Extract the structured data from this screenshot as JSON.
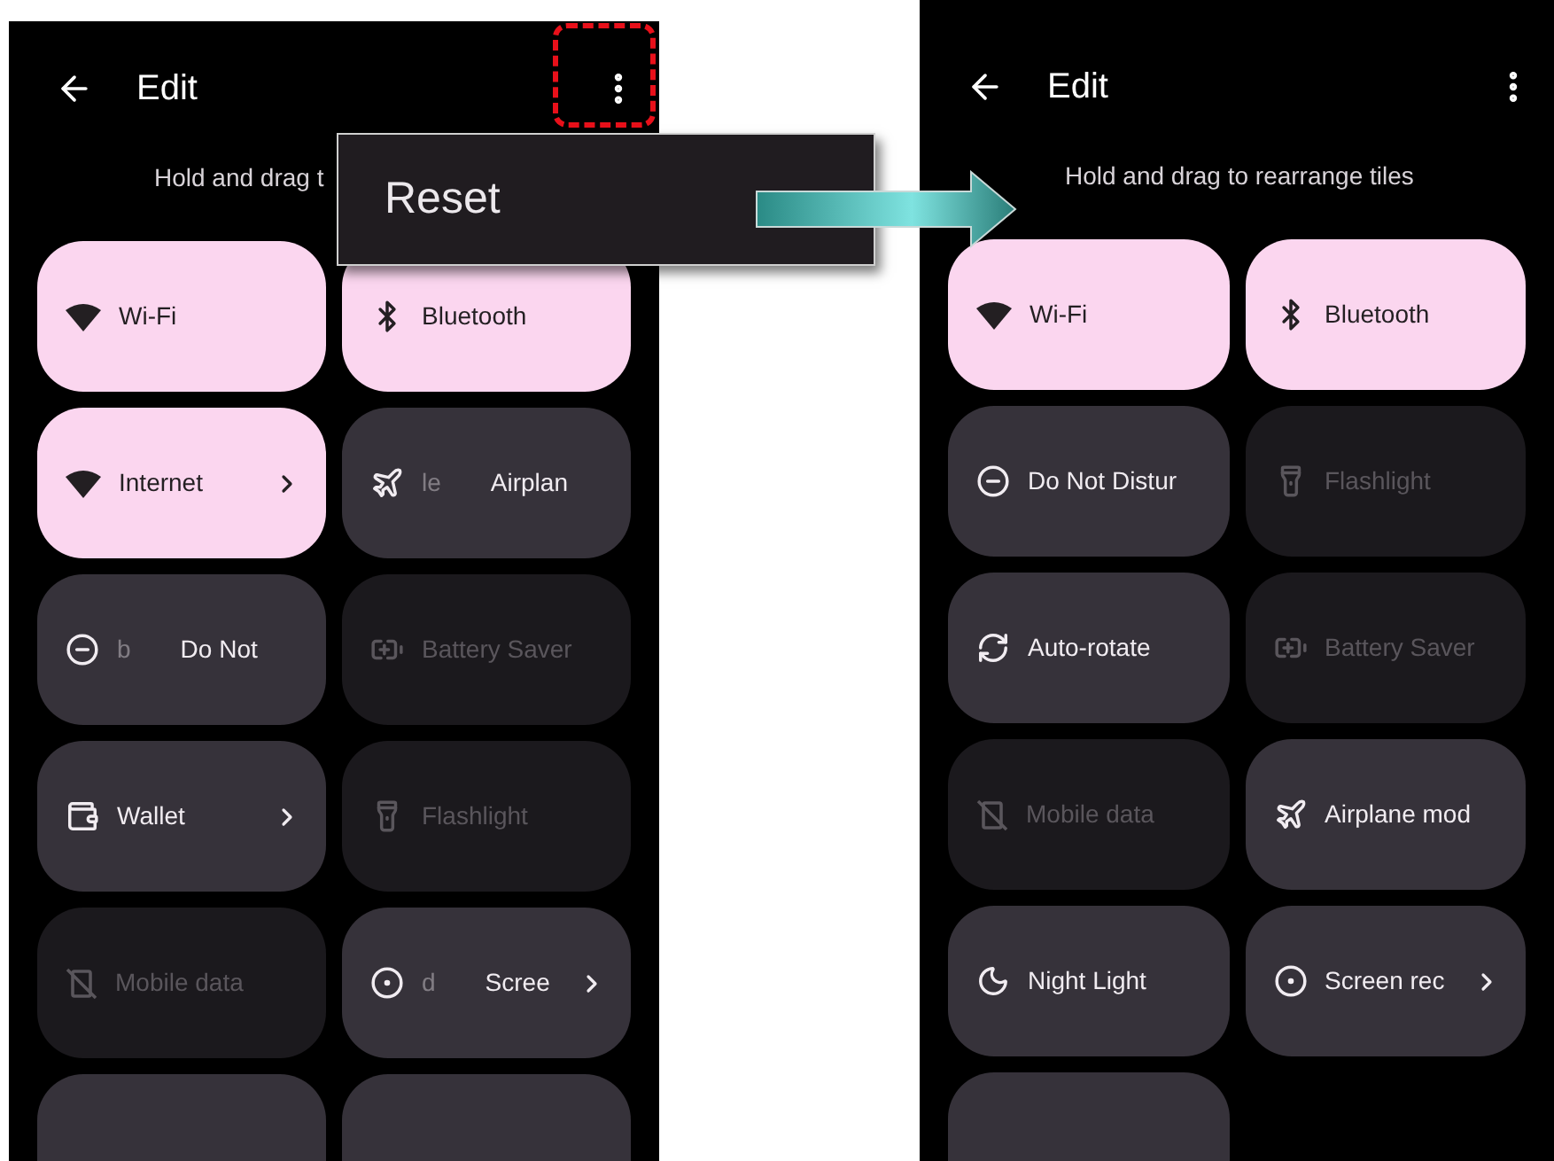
{
  "phones": [
    {
      "title": "Edit",
      "hint": "Hold and drag t",
      "tiles": [
        {
          "kind": "wifi",
          "on": true,
          "disabled": false,
          "label": "Wi-Fi",
          "chevron": false
        },
        {
          "kind": "bluetooth",
          "on": true,
          "disabled": false,
          "label": "Bluetooth",
          "chevron": false
        },
        {
          "kind": "wifi",
          "on": true,
          "disabled": false,
          "label": "Internet",
          "chevron": true
        },
        {
          "kind": "airplane",
          "on": false,
          "disabled": false,
          "ghost": "le",
          "label": "Airplan",
          "chevron": false
        },
        {
          "kind": "dnd",
          "on": false,
          "disabled": false,
          "ghost": "b",
          "label": "Do Not",
          "chevron": false
        },
        {
          "kind": "battery",
          "on": false,
          "disabled": true,
          "label": "Battery Saver",
          "chevron": false
        },
        {
          "kind": "wallet",
          "on": false,
          "disabled": false,
          "label": "Wallet",
          "chevron": true
        },
        {
          "kind": "flashlight",
          "on": false,
          "disabled": true,
          "label": "Flashlight",
          "chevron": false
        },
        {
          "kind": "mobile",
          "on": false,
          "disabled": true,
          "label": "Mobile data",
          "chevron": false
        },
        {
          "kind": "record",
          "on": false,
          "disabled": false,
          "ghost": "d",
          "label": "Scree",
          "chevron": true
        },
        {
          "kind": "blank",
          "on": false,
          "disabled": false,
          "chevron": false
        },
        {
          "kind": "blank",
          "on": false,
          "disabled": false,
          "chevron": false
        }
      ]
    },
    {
      "title": "Edit",
      "hint": "Hold and drag to rearrange tiles",
      "tiles": [
        {
          "kind": "wifi",
          "on": true,
          "disabled": false,
          "label": "Wi-Fi",
          "chevron": false
        },
        {
          "kind": "bluetooth",
          "on": true,
          "disabled": false,
          "label": "Bluetooth",
          "chevron": false
        },
        {
          "kind": "dnd",
          "on": false,
          "disabled": false,
          "label": "Do Not Distur",
          "chevron": false
        },
        {
          "kind": "flashlight",
          "on": false,
          "disabled": true,
          "label": "Flashlight",
          "chevron": false
        },
        {
          "kind": "rotate",
          "on": false,
          "disabled": false,
          "label": "Auto-rotate",
          "chevron": false
        },
        {
          "kind": "battery",
          "on": false,
          "disabled": true,
          "label": "Battery Saver",
          "chevron": false
        },
        {
          "kind": "mobile",
          "on": false,
          "disabled": true,
          "label": "Mobile data",
          "chevron": false
        },
        {
          "kind": "airplane",
          "on": false,
          "disabled": false,
          "label": "Airplane mod",
          "chevron": false
        },
        {
          "kind": "moon",
          "on": false,
          "disabled": false,
          "label": "Night Light",
          "chevron": false
        },
        {
          "kind": "record",
          "on": false,
          "disabled": false,
          "label": "Screen rec",
          "chevron": true
        },
        {
          "kind": "blank",
          "on": false,
          "disabled": false,
          "chevron": false
        }
      ]
    }
  ],
  "menu": {
    "items": [
      "Reset"
    ]
  }
}
